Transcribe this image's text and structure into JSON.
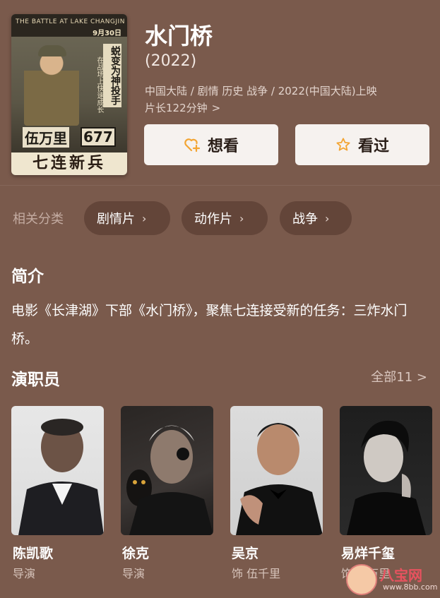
{
  "movie": {
    "title": "水门桥",
    "year": "(2022)",
    "meta_line1": "中国大陆 / 剧情 历史 战争 / 2022(中国大陆)上映",
    "meta_line2": "片长122分钟",
    "chevron": ">"
  },
  "poster": {
    "top_text": "THE BATTLE AT LAKE CHANGJIN",
    "date": "9月30日",
    "vertical_main": "蜕变为神投手",
    "vertical_sub": "在战场上快速成长",
    "name": "伍万里",
    "number": "677",
    "title": "七连新兵"
  },
  "actions": {
    "want_label": "想看",
    "seen_label": "看过"
  },
  "tags": {
    "label": "相关分类",
    "items": [
      "剧情片",
      "动作片",
      "战争"
    ]
  },
  "intro": {
    "title": "简介",
    "text": "电影《长津湖》下部《水门桥》，聚焦七连接受新的任务：三炸水门桥。"
  },
  "cast": {
    "title": "演职员",
    "all_label": "全部11 >",
    "members": [
      {
        "name": "陈凯歌",
        "role": "导演"
      },
      {
        "name": "徐克",
        "role": "导演"
      },
      {
        "name": "吴京",
        "role": "饰 伍千里"
      },
      {
        "name": "易烊千玺",
        "role": "饰 伍万里"
      }
    ]
  },
  "watermark": {
    "text": "八宝网",
    "url": "www.8bb.com"
  },
  "colors": {
    "background": "#7a5a4c",
    "button_bg": "#f6f2ef",
    "want_icon": "#f3a533",
    "seen_icon": "#f3a533",
    "watermark": "#e8525f"
  }
}
